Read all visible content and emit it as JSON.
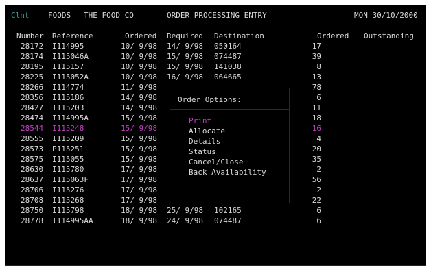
{
  "header": {
    "client_label": "Clnt",
    "client_code": "FOODS",
    "company": "THE FOOD CO",
    "screen_title": "ORDER PROCESSING ENTRY",
    "date": "MON 30/10/2000"
  },
  "columns": {
    "number": "Number",
    "reference": "Reference",
    "ordered_date": "Ordered",
    "required": "Required",
    "destination": "Destination",
    "ordered_qty": "Ordered",
    "outstanding": "Outstanding"
  },
  "rows": [
    {
      "number": "28172",
      "reference": "I114995",
      "ordered": "10/ 9/98",
      "required": "14/ 9/98",
      "destination": "050164",
      "qty": "17",
      "selected": false
    },
    {
      "number": "28174",
      "reference": "I115046A",
      "ordered": "10/ 9/98",
      "required": "15/ 9/98",
      "destination": "074487",
      "qty": "39",
      "selected": false
    },
    {
      "number": "28195",
      "reference": "I115157",
      "ordered": "10/ 9/98",
      "required": "15/ 9/98",
      "destination": "141038",
      "qty": "8",
      "selected": false
    },
    {
      "number": "28225",
      "reference": "I115052A",
      "ordered": "10/ 9/98",
      "required": "16/ 9/98",
      "destination": "064665",
      "qty": "13",
      "selected": false
    },
    {
      "number": "28266",
      "reference": "I114774",
      "ordered": "11/ 9/98",
      "required": "",
      "destination": "",
      "qty": "78",
      "selected": false
    },
    {
      "number": "28356",
      "reference": "I115186",
      "ordered": "14/ 9/98",
      "required": "",
      "destination": "",
      "qty": "6",
      "selected": false
    },
    {
      "number": "28427",
      "reference": "I115203",
      "ordered": "14/ 9/98",
      "required": "",
      "destination": "",
      "qty": "11",
      "selected": false
    },
    {
      "number": "28474",
      "reference": "I114995A",
      "ordered": "15/ 9/98",
      "required": "",
      "destination": "",
      "qty": "18",
      "selected": false
    },
    {
      "number": "28544",
      "reference": "I115248",
      "ordered": "15/ 9/98",
      "required": "",
      "destination": "",
      "qty": "16",
      "selected": true
    },
    {
      "number": "28555",
      "reference": "I115209",
      "ordered": "15/ 9/98",
      "required": "",
      "destination": "",
      "qty": "4",
      "selected": false
    },
    {
      "number": "28573",
      "reference": "P115251",
      "ordered": "15/ 9/98",
      "required": "",
      "destination": "",
      "qty": "20",
      "selected": false
    },
    {
      "number": "28575",
      "reference": "I115055",
      "ordered": "15/ 9/98",
      "required": "",
      "destination": "",
      "qty": "35",
      "selected": false
    },
    {
      "number": "28630",
      "reference": "I115780",
      "ordered": "17/ 9/98",
      "required": "",
      "destination": "",
      "qty": "2",
      "selected": false
    },
    {
      "number": "28637",
      "reference": "I115063F",
      "ordered": "17/ 9/98",
      "required": "",
      "destination": "",
      "qty": "56",
      "selected": false
    },
    {
      "number": "28706",
      "reference": "I115276",
      "ordered": "17/ 9/98",
      "required": "",
      "destination": "",
      "qty": "2",
      "selected": false
    },
    {
      "number": "28708",
      "reference": "I115268",
      "ordered": "17/ 9/98",
      "required": "",
      "destination": "",
      "qty": "22",
      "selected": false
    },
    {
      "number": "28750",
      "reference": "I115798",
      "ordered": "18/ 9/98",
      "required": "25/ 9/98",
      "destination": "102165",
      "qty": "6",
      "selected": false
    },
    {
      "number": "28778",
      "reference": "I114995AA",
      "ordered": "18/ 9/98",
      "required": "24/ 9/98",
      "destination": "074487",
      "qty": "6",
      "selected": false
    }
  ],
  "popup": {
    "title": "Order Options:",
    "options": [
      {
        "label": "Print",
        "highlighted": true
      },
      {
        "label": "Allocate",
        "highlighted": false
      },
      {
        "label": "Details",
        "highlighted": false
      },
      {
        "label": "Status",
        "highlighted": false
      },
      {
        "label": "Cancel/Close",
        "highlighted": false
      },
      {
        "label": "Back Availability",
        "highlighted": false
      }
    ]
  },
  "colors": {
    "background": "#000000",
    "text": "#d8d8d8",
    "accent_cyan": "#2aa0a0",
    "highlight_purple": "#c040c0",
    "border_red": "#8b0000"
  }
}
